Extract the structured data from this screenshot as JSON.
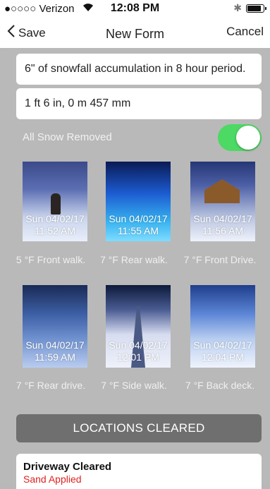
{
  "status": {
    "carrier": "●○○○○ Verizon",
    "time": "12:08 PM"
  },
  "nav": {
    "back_label": "Save",
    "title": "New Form",
    "cancel_label": "Cancel"
  },
  "form": {
    "description": "6\" of snowfall accumulation in 8 hour period.",
    "depth": "1 ft 6 in, 0 m 457 mm",
    "toggle_label": "All Snow Removed",
    "toggle_on": true
  },
  "photos": [
    {
      "date": "Sun 04/02/17",
      "time": "11:52 AM",
      "caption": "5 °F Front walk."
    },
    {
      "date": "Sun 04/02/17",
      "time": "11:55 AM",
      "caption": "7 °F Rear walk."
    },
    {
      "date": "Sun 04/02/17",
      "time": "11:56 AM",
      "caption": "7 °F Front Drive."
    },
    {
      "date": "Sun 04/02/17",
      "time": "11:59 AM",
      "caption": "7 °F Rear drive."
    },
    {
      "date": "Sun 04/02/17",
      "time": "12:01 PM",
      "caption": "7 °F Side walk."
    },
    {
      "date": "Sun 04/02/17",
      "time": "12:04 PM",
      "caption": "7 °F Back deck."
    }
  ],
  "section": {
    "title": "LOCATIONS CLEARED"
  },
  "locations": [
    {
      "title": "Driveway Cleared",
      "subtitle": "Sand Applied"
    }
  ],
  "colors": {
    "toggle_on": "#4cd964",
    "section_bar": "#6f6f6f",
    "subtitle_red": "#e02020"
  }
}
